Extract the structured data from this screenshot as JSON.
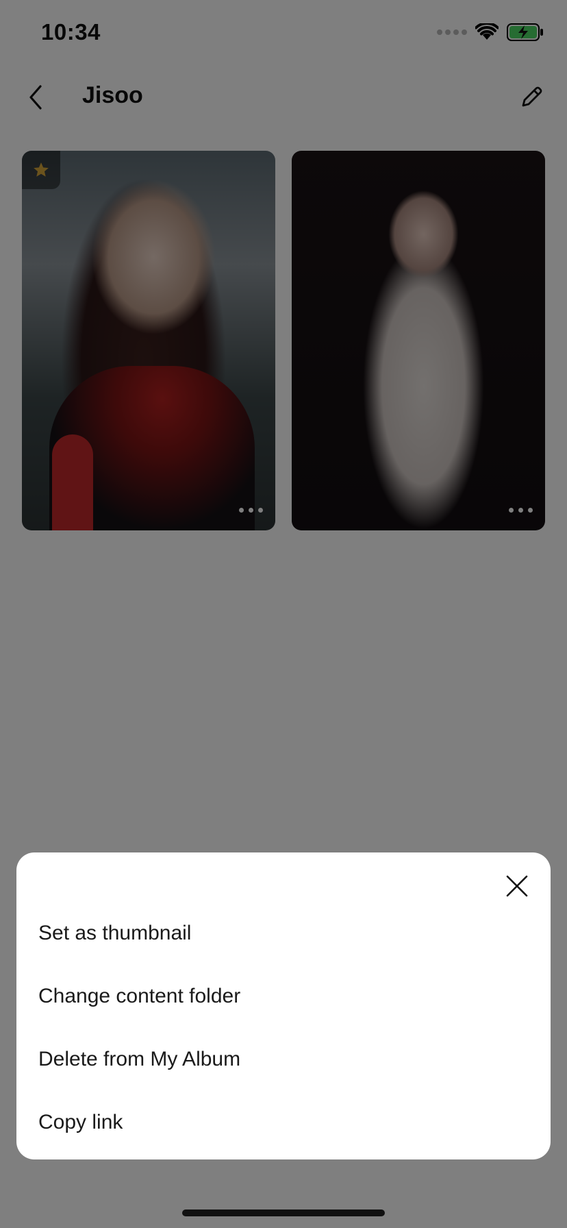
{
  "status_bar": {
    "time": "10:34"
  },
  "nav": {
    "title": "Jisoo"
  },
  "icons": {
    "back": "chevron-left-icon",
    "edit": "pencil-icon",
    "favorite": "star-icon",
    "more": "more-horizontal-icon",
    "close": "close-icon"
  },
  "colors": {
    "star": "#d7a63a",
    "overlay": "rgba(0,0,0,0.5)"
  },
  "album": {
    "items": [
      {
        "is_thumbnail": true
      },
      {
        "is_thumbnail": false
      }
    ]
  },
  "sheet": {
    "items": [
      "Set as thumbnail",
      "Change content folder",
      "Delete from My Album",
      "Copy link"
    ]
  }
}
